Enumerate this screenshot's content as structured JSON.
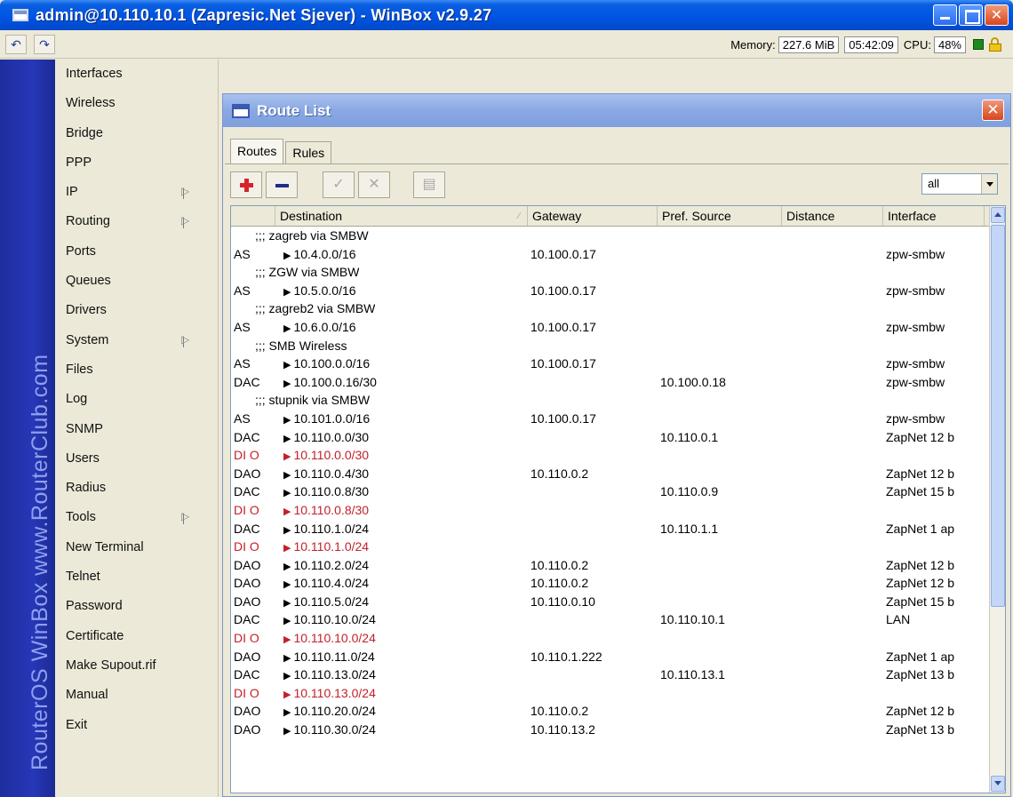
{
  "window": {
    "title": "admin@10.110.10.1 (Zapresic.Net Sjever) - WinBox v2.9.27"
  },
  "status": {
    "memory_label": "Memory:",
    "memory_value": "227.6 MiB",
    "time": "05:42:09",
    "cpu_label": "CPU:",
    "cpu_value": "48%"
  },
  "brand_text": "RouterOS WinBox   www.RouterClub.com",
  "menu": [
    {
      "label": "Interfaces",
      "submenu": false
    },
    {
      "label": "Wireless",
      "submenu": false
    },
    {
      "label": "Bridge",
      "submenu": false
    },
    {
      "label": "PPP",
      "submenu": false
    },
    {
      "label": "IP",
      "submenu": true
    },
    {
      "label": "Routing",
      "submenu": true
    },
    {
      "label": "Ports",
      "submenu": false
    },
    {
      "label": "Queues",
      "submenu": false
    },
    {
      "label": "Drivers",
      "submenu": false
    },
    {
      "label": "System",
      "submenu": true
    },
    {
      "label": "Files",
      "submenu": false
    },
    {
      "label": "Log",
      "submenu": false
    },
    {
      "label": "SNMP",
      "submenu": false
    },
    {
      "label": "Users",
      "submenu": false
    },
    {
      "label": "Radius",
      "submenu": false
    },
    {
      "label": "Tools",
      "submenu": true
    },
    {
      "label": "New Terminal",
      "submenu": false
    },
    {
      "label": "Telnet",
      "submenu": false
    },
    {
      "label": "Password",
      "submenu": false
    },
    {
      "label": "Certificate",
      "submenu": false
    },
    {
      "label": "Make Supout.rif",
      "submenu": false
    },
    {
      "label": "Manual",
      "submenu": false
    },
    {
      "label": "Exit",
      "submenu": false
    }
  ],
  "route_list": {
    "title": "Route List",
    "tabs": [
      {
        "label": "Routes",
        "active": true
      },
      {
        "label": "Rules",
        "active": false
      }
    ],
    "filter_value": "all",
    "columns": [
      "Destination",
      "Gateway",
      "Pref. Source",
      "Distance",
      "Interface"
    ],
    "rows": [
      {
        "comment": ";;; zagreb via SMBW"
      },
      {
        "flags": "AS",
        "dst": "10.4.0.0/16",
        "gw": "10.100.0.17",
        "src": "",
        "dist": "",
        "iface": "zpw-smbw"
      },
      {
        "comment": ";;; ZGW via SMBW"
      },
      {
        "flags": "AS",
        "dst": "10.5.0.0/16",
        "gw": "10.100.0.17",
        "src": "",
        "dist": "",
        "iface": "zpw-smbw"
      },
      {
        "comment": ";;; zagreb2 via SMBW"
      },
      {
        "flags": "AS",
        "dst": "10.6.0.0/16",
        "gw": "10.100.0.17",
        "src": "",
        "dist": "",
        "iface": "zpw-smbw"
      },
      {
        "comment": ";;; SMB Wireless"
      },
      {
        "flags": "AS",
        "dst": "10.100.0.0/16",
        "gw": "10.100.0.17",
        "src": "",
        "dist": "",
        "iface": "zpw-smbw"
      },
      {
        "flags": "DAC",
        "dst": "10.100.0.16/30",
        "gw": "",
        "src": "10.100.0.18",
        "dist": "",
        "iface": "zpw-smbw"
      },
      {
        "comment": ";;; stupnik via SMBW"
      },
      {
        "flags": "AS",
        "dst": "10.101.0.0/16",
        "gw": "10.100.0.17",
        "src": "",
        "dist": "",
        "iface": "zpw-smbw"
      },
      {
        "flags": "DAC",
        "dst": "10.110.0.0/30",
        "gw": "",
        "src": "10.110.0.1",
        "dist": "",
        "iface": "ZapNet 12 b"
      },
      {
        "flags": "DI O",
        "dst": "10.110.0.0/30",
        "gw": "",
        "src": "",
        "dist": "",
        "iface": "",
        "inactive": true
      },
      {
        "flags": "DAO",
        "dst": "10.110.0.4/30",
        "gw": "10.110.0.2",
        "src": "",
        "dist": "",
        "iface": "ZapNet 12 b"
      },
      {
        "flags": "DAC",
        "dst": "10.110.0.8/30",
        "gw": "",
        "src": "10.110.0.9",
        "dist": "",
        "iface": "ZapNet 15 b"
      },
      {
        "flags": "DI O",
        "dst": "10.110.0.8/30",
        "gw": "",
        "src": "",
        "dist": "",
        "iface": "",
        "inactive": true
      },
      {
        "flags": "DAC",
        "dst": "10.110.1.0/24",
        "gw": "",
        "src": "10.110.1.1",
        "dist": "",
        "iface": "ZapNet 1 ap"
      },
      {
        "flags": "DI O",
        "dst": "10.110.1.0/24",
        "gw": "",
        "src": "",
        "dist": "",
        "iface": "",
        "inactive": true
      },
      {
        "flags": "DAO",
        "dst": "10.110.2.0/24",
        "gw": "10.110.0.2",
        "src": "",
        "dist": "",
        "iface": "ZapNet 12 b"
      },
      {
        "flags": "DAO",
        "dst": "10.110.4.0/24",
        "gw": "10.110.0.2",
        "src": "",
        "dist": "",
        "iface": "ZapNet 12 b"
      },
      {
        "flags": "DAO",
        "dst": "10.110.5.0/24",
        "gw": "10.110.0.10",
        "src": "",
        "dist": "",
        "iface": "ZapNet 15 b"
      },
      {
        "flags": "DAC",
        "dst": "10.110.10.0/24",
        "gw": "",
        "src": "10.110.10.1",
        "dist": "",
        "iface": "LAN"
      },
      {
        "flags": "DI O",
        "dst": "10.110.10.0/24",
        "gw": "",
        "src": "",
        "dist": "",
        "iface": "",
        "inactive": true
      },
      {
        "flags": "DAO",
        "dst": "10.110.11.0/24",
        "gw": "10.110.1.222",
        "src": "",
        "dist": "",
        "iface": "ZapNet 1 ap"
      },
      {
        "flags": "DAC",
        "dst": "10.110.13.0/24",
        "gw": "",
        "src": "10.110.13.1",
        "dist": "",
        "iface": "ZapNet 13 b"
      },
      {
        "flags": "DI O",
        "dst": "10.110.13.0/24",
        "gw": "",
        "src": "",
        "dist": "",
        "iface": "",
        "inactive": true
      },
      {
        "flags": "DAO",
        "dst": "10.110.20.0/24",
        "gw": "10.110.0.2",
        "src": "",
        "dist": "",
        "iface": "ZapNet 12 b"
      },
      {
        "flags": "DAO",
        "dst": "10.110.30.0/24",
        "gw": "10.110.13.2",
        "src": "",
        "dist": "",
        "iface": "ZapNet 13 b"
      }
    ]
  }
}
